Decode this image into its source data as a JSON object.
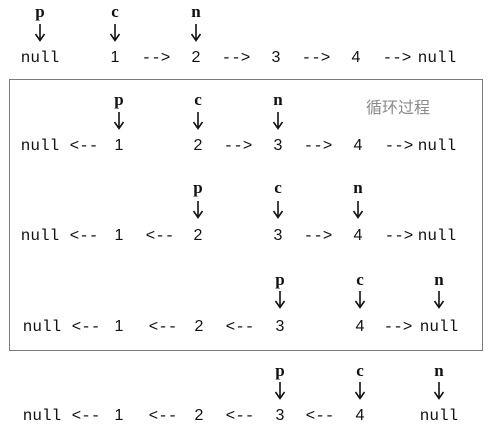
{
  "loop_caption": "循环过程",
  "pointer_labels": {
    "p": "p",
    "c": "c",
    "n": "n"
  },
  "symbols": {
    "null": "null",
    "forward_arrow": "-->",
    "back_arrow": "<--",
    "nodes": [
      "1",
      "2",
      "3",
      "4"
    ]
  },
  "rows": [
    {
      "id": "initial",
      "chain": [
        "null",
        "1",
        "-->",
        "2",
        "-->",
        "3",
        "-->",
        "4",
        "-->",
        "null"
      ],
      "pointers": {
        "p": "null",
        "c": "1",
        "n": "2"
      }
    },
    {
      "id": "iteration-1",
      "chain": [
        "null",
        "<--",
        "1",
        "2",
        "-->",
        "3",
        "-->",
        "4",
        "-->",
        "null"
      ],
      "pointers": {
        "p": "1",
        "c": "2",
        "n": "3"
      }
    },
    {
      "id": "iteration-2",
      "chain": [
        "null",
        "<--",
        "1",
        "<--",
        "2",
        "3",
        "-->",
        "4",
        "-->",
        "null"
      ],
      "pointers": {
        "p": "2",
        "c": "3",
        "n": "4"
      }
    },
    {
      "id": "iteration-3",
      "chain": [
        "null",
        "<--",
        "1",
        "<--",
        "2",
        "<--",
        "3",
        "4",
        "-->",
        "null"
      ],
      "pointers": {
        "p": "3",
        "c": "4",
        "n": "null"
      }
    },
    {
      "id": "final",
      "chain": [
        "null",
        "<--",
        "1",
        "<--",
        "2",
        "<--",
        "3",
        "<--",
        "4",
        "null"
      ],
      "pointers": {
        "p": "3",
        "c": "4",
        "n": "null"
      }
    }
  ]
}
